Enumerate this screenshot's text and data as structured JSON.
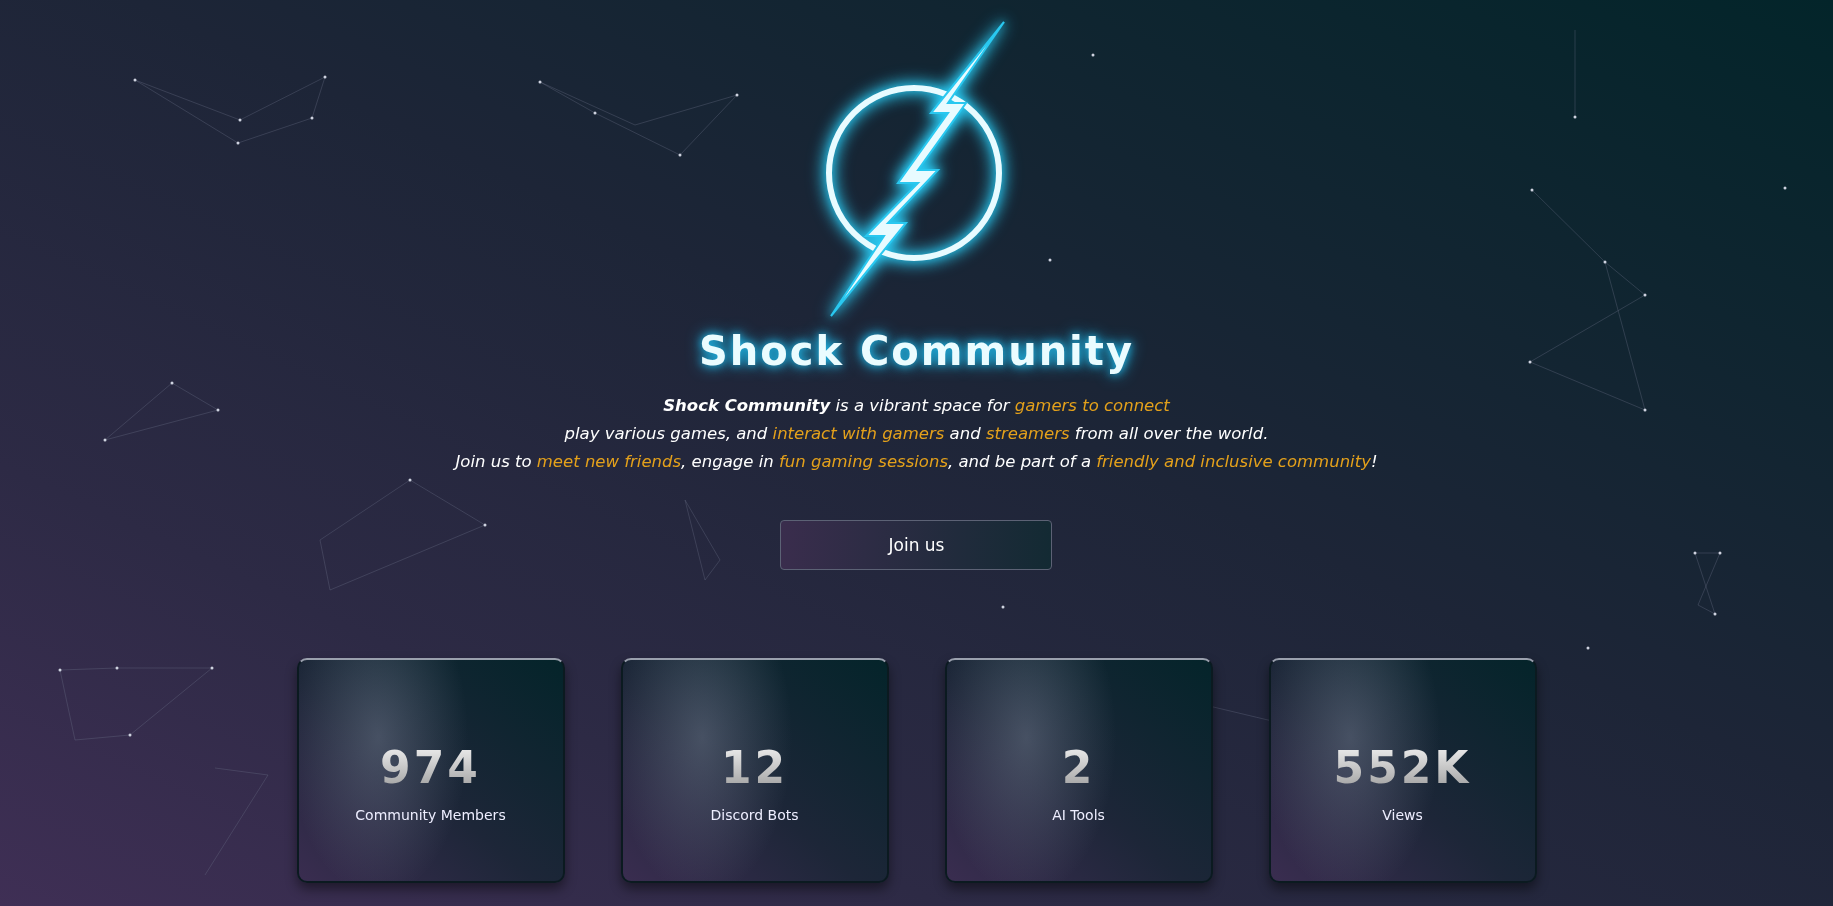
{
  "hero": {
    "title": "Shock Community",
    "description": [
      [
        {
          "text": "**Shock Community** is a vibrant space for ",
          "highlight": false
        },
        {
          "text": "gamers to connect",
          "highlight": true
        }
      ],
      [
        {
          "text": "play various games, and ",
          "highlight": false
        },
        {
          "text": "interact with gamers",
          "highlight": true
        },
        {
          "text": " and ",
          "highlight": false
        },
        {
          "text": "streamers",
          "highlight": true
        },
        {
          "text": " from all over the world.",
          "highlight": false
        }
      ],
      [
        {
          "text": "Join us to ",
          "highlight": false
        },
        {
          "text": "meet new friends",
          "highlight": true
        },
        {
          "text": ", engage in ",
          "highlight": false
        },
        {
          "text": "fun gaming sessions",
          "highlight": true
        },
        {
          "text": ", and be part of a ",
          "highlight": false
        },
        {
          "text": "friendly and inclusive community",
          "highlight": true
        },
        {
          "text": "!",
          "highlight": false
        }
      ]
    ],
    "button": "Join us"
  },
  "stats": [
    {
      "value": "974",
      "label": "Community Members"
    },
    {
      "value": "12",
      "label": "Discord Bots"
    },
    {
      "value": "2",
      "label": "AI Tools"
    },
    {
      "value": "552K",
      "label": "Views"
    }
  ]
}
